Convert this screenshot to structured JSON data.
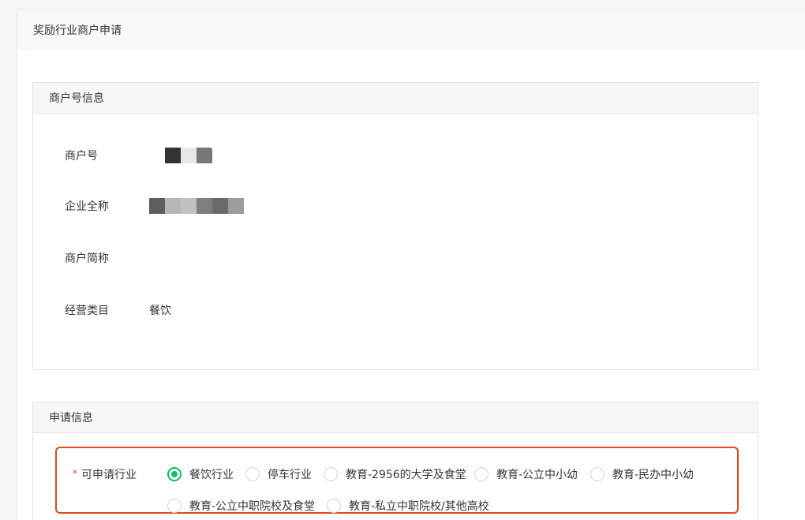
{
  "page": {
    "title": "奖励行业商户申请"
  },
  "merchant_info": {
    "section_title": "商户号信息",
    "rows": [
      {
        "label": "商户号",
        "value": ""
      },
      {
        "label": "企业全称",
        "value": ""
      },
      {
        "label": "商户简称",
        "value": ""
      },
      {
        "label": "经营类目",
        "value": "餐饮"
      }
    ],
    "merchant_id_mosaic": [
      "#333333",
      "#e8e8e8",
      "#777777"
    ],
    "company_name_mosaic": [
      "#5e5e5e",
      "#b7b7b7",
      "#c1c1c1",
      "#7e7e7e",
      "#6a6a6a",
      "#9c9c9c"
    ]
  },
  "application": {
    "section_title": "申请信息",
    "industry_label": "可申请行业",
    "required_mark": "*",
    "industry_options": [
      {
        "label": "餐饮行业",
        "checked": true
      },
      {
        "label": "停车行业",
        "checked": false
      },
      {
        "label": "教育-2956的大学及食堂",
        "checked": false
      },
      {
        "label": "教育-公立中小幼",
        "checked": false
      },
      {
        "label": "教育-民办中小幼",
        "checked": false
      },
      {
        "label": "教育-公立中职院校及食堂",
        "checked": false
      },
      {
        "label": "教育-私立中职院校/其他高校",
        "checked": false
      }
    ]
  },
  "colors": {
    "accent": "#07c160",
    "highlight_border": "#e8471f",
    "required": "#e34d3c"
  }
}
